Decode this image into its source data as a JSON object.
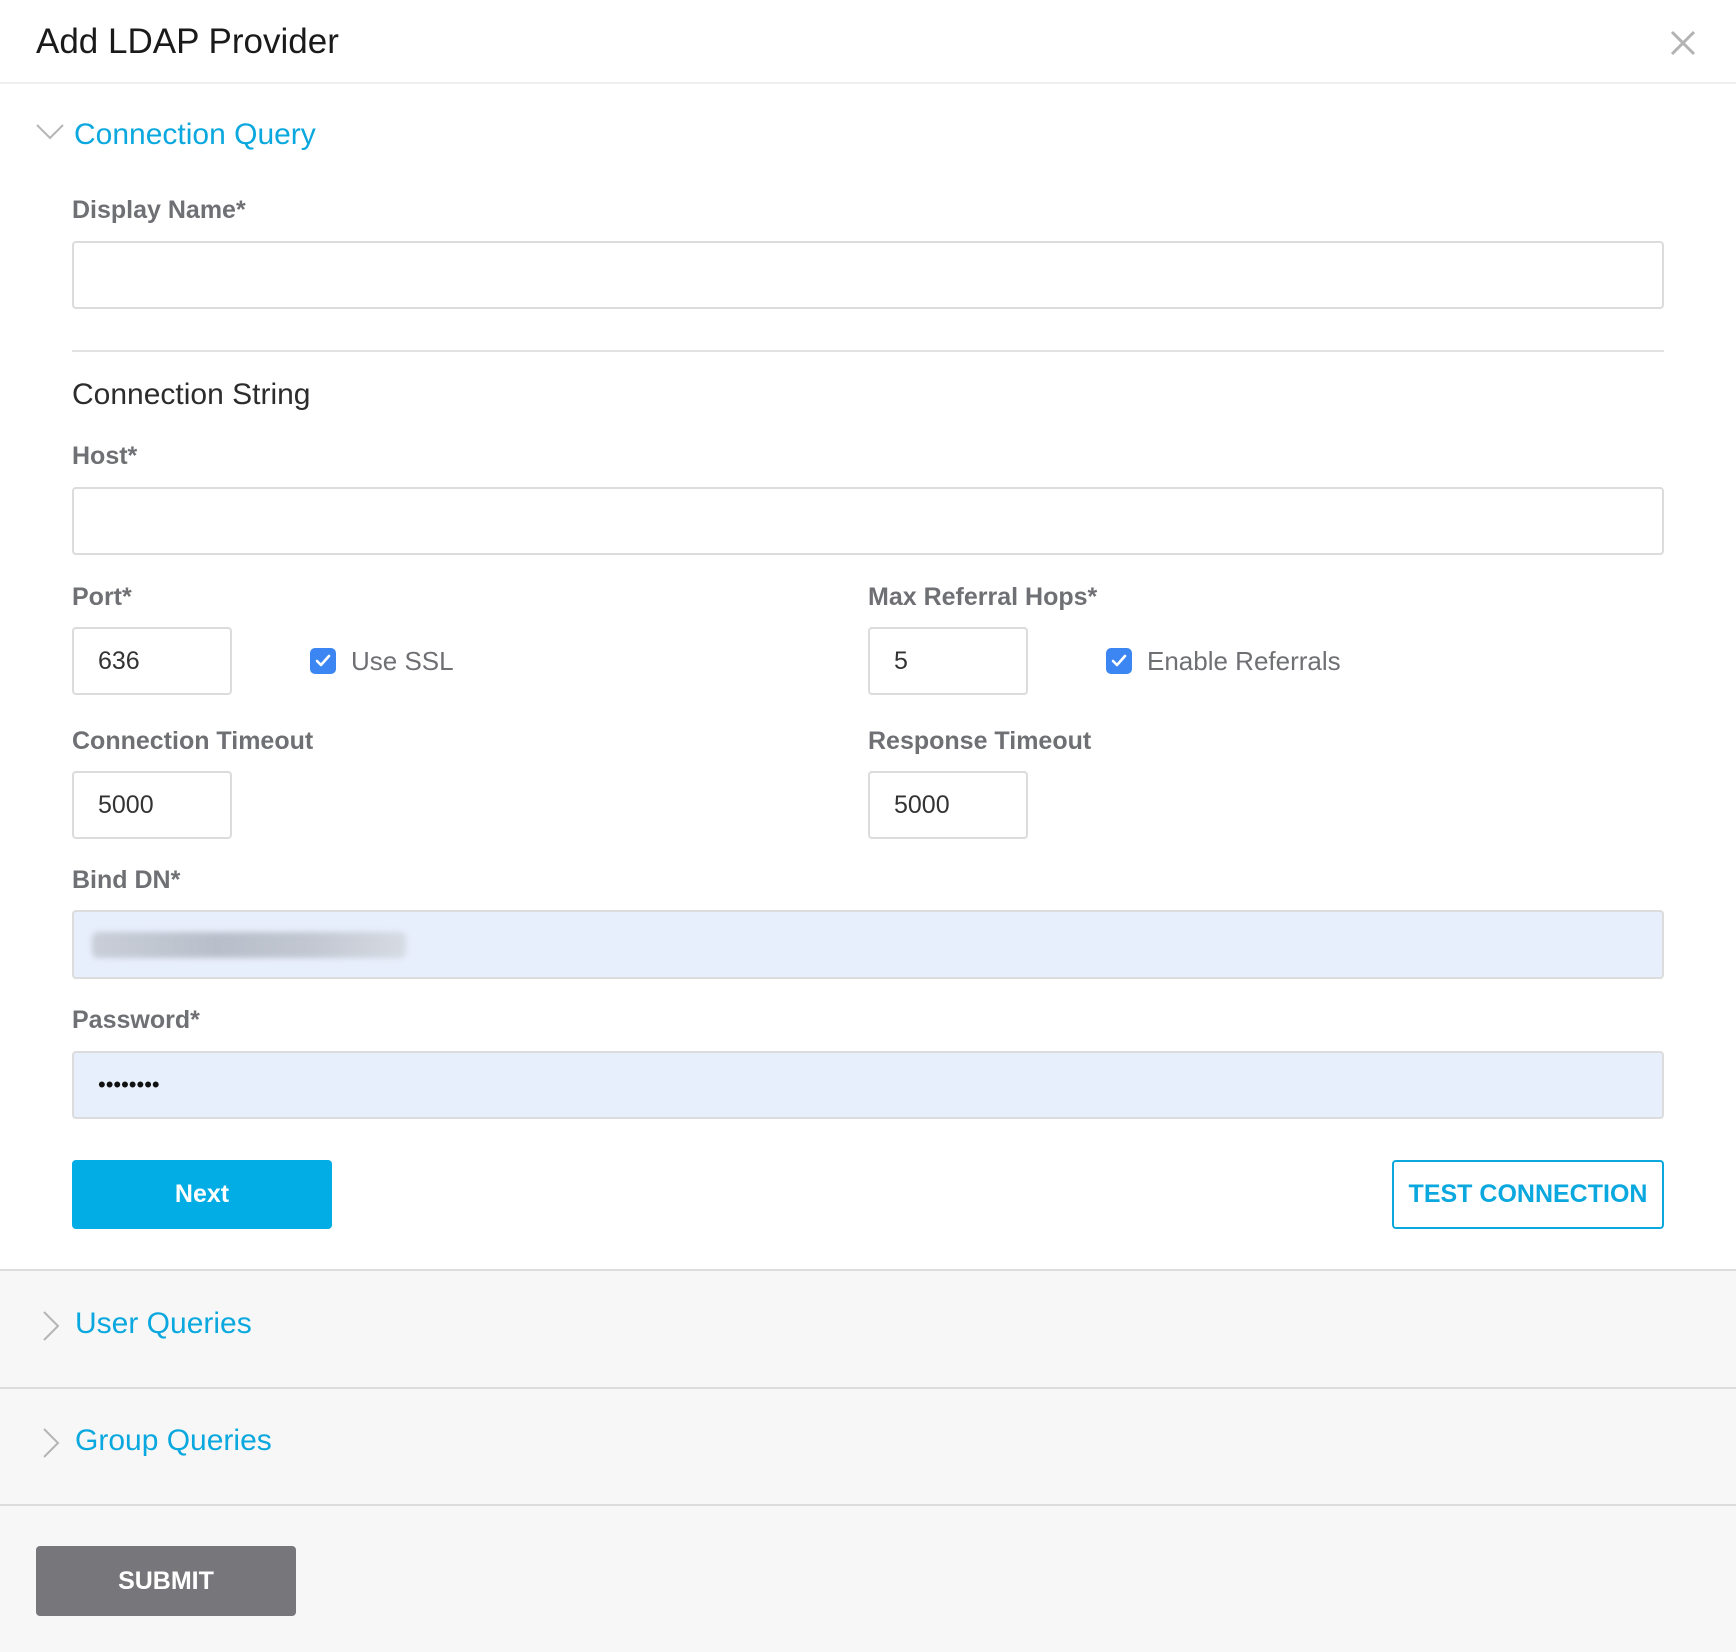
{
  "dialog": {
    "title": "Add LDAP Provider",
    "close_icon": "close-icon"
  },
  "sections": {
    "connection_query": {
      "title": "Connection Query",
      "expanded": true,
      "icon": "chevron-down-icon"
    },
    "user_queries": {
      "title": "User Queries",
      "expanded": false,
      "icon": "chevron-right-icon"
    },
    "group_queries": {
      "title": "Group Queries",
      "expanded": false,
      "icon": "chevron-right-icon"
    }
  },
  "form": {
    "display_name": {
      "label": "Display Name*",
      "value": ""
    },
    "connection_string_heading": "Connection String",
    "host": {
      "label": "Host*",
      "value": ""
    },
    "port": {
      "label": "Port*",
      "value": "636"
    },
    "use_ssl": {
      "label": "Use SSL",
      "checked": true
    },
    "max_referral_hops": {
      "label": "Max Referral Hops*",
      "value": "5"
    },
    "enable_referrals": {
      "label": "Enable Referrals",
      "checked": true
    },
    "connection_timeout": {
      "label": "Connection Timeout",
      "value": "5000"
    },
    "response_timeout": {
      "label": "Response Timeout",
      "value": "5000"
    },
    "bind_dn": {
      "label": "Bind DN*",
      "value": "[redacted]"
    },
    "password": {
      "label": "Password*",
      "value": "••••••••"
    }
  },
  "buttons": {
    "next": "Next",
    "test_connection": "TEST CONNECTION",
    "submit": "SUBMIT"
  },
  "colors": {
    "accent": "#0aa8de",
    "primary_button": "#02ace4",
    "checkbox": "#3b86f2",
    "submit_button": "#77777b",
    "autofill_bg": "#e8effc"
  }
}
